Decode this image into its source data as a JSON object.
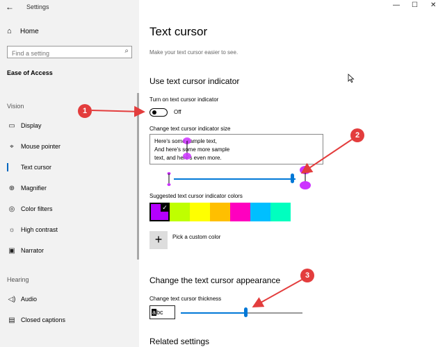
{
  "app": {
    "title": "Settings",
    "back_glyph": "←",
    "window_controls": [
      "—",
      "☐",
      "✕"
    ]
  },
  "sidebar": {
    "home": {
      "label": "Home",
      "icon": "home-icon"
    },
    "search": {
      "placeholder": "Find a setting",
      "value": ""
    },
    "section_title": "Ease of Access",
    "groups": [
      {
        "label": "Vision",
        "items": [
          {
            "label": "Display",
            "icon": "display-icon"
          },
          {
            "label": "Mouse pointer",
            "icon": "mouse-pointer-icon"
          },
          {
            "label": "Text cursor",
            "icon": "text-cursor-icon",
            "active": true
          },
          {
            "label": "Magnifier",
            "icon": "magnifier-icon"
          },
          {
            "label": "Color filters",
            "icon": "color-filters-icon"
          },
          {
            "label": "High contrast",
            "icon": "high-contrast-icon"
          },
          {
            "label": "Narrator",
            "icon": "narrator-icon"
          }
        ]
      },
      {
        "label": "Hearing",
        "items": [
          {
            "label": "Audio",
            "icon": "audio-icon"
          },
          {
            "label": "Closed captions",
            "icon": "closed-captions-icon"
          }
        ]
      }
    ]
  },
  "main": {
    "title": "Text cursor",
    "subtitle": "Make your text cursor easier to see.",
    "indicator_section": {
      "heading": "Use text cursor indicator",
      "toggle_label": "Turn on text cursor indicator",
      "toggle_state": "Off",
      "size_label": "Change text cursor indicator size",
      "sample_lines": [
        "Here's some sample text,",
        "And here's some more sample",
        "text, and here's even more."
      ],
      "size_level": 0.97,
      "colors_label": "Suggested text cursor indicator colors",
      "colors": [
        "#b400ff",
        "#bfff00",
        "#ffff00",
        "#ffbf00",
        "#ff00bf",
        "#00bfff",
        "#00ffbf"
      ],
      "selected_color_index": 0,
      "custom_color_label": "Pick a custom color",
      "custom_color_glyph": "+"
    },
    "appearance_section": {
      "heading": "Change the text cursor appearance",
      "thickness_label": "Change text cursor thickness",
      "preview_cursor_char": "a",
      "preview_rest": "bc",
      "thickness_level": 0.53
    },
    "related_heading": "Related settings"
  },
  "annotations": [
    "1",
    "2",
    "3"
  ],
  "colors": {
    "accent": "#0078d7",
    "annotation": "#e33d3d",
    "indicator": "#b400ff"
  }
}
